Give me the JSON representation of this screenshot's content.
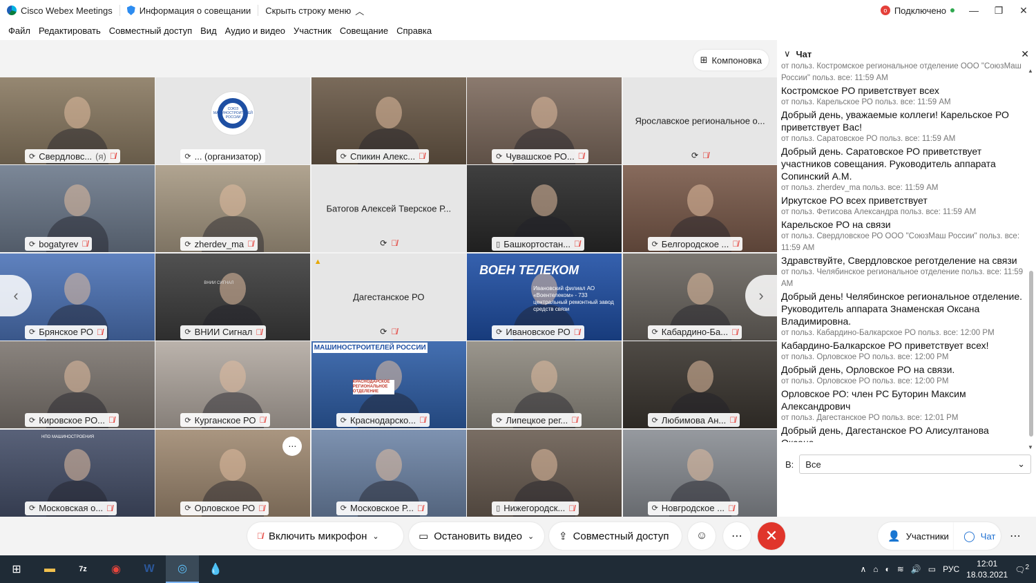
{
  "titlebar": {
    "app": "Cisco Webex Meetings",
    "meeting_info": "Информация о совещании",
    "hide_menu": "Скрыть строку меню",
    "rec_badge": "o",
    "status": "Подключено"
  },
  "menu": [
    "Файл",
    "Редактировать",
    "Совместный доступ",
    "Вид",
    "Аудио и видео",
    "Участник",
    "Совещание",
    "Справка"
  ],
  "layout_button": "Компоновка",
  "tiles": [
    {
      "name": "Свердловс...",
      "suffix": "(я)",
      "kind": "video",
      "bg": "#8a7a62"
    },
    {
      "name": "... (организатор)",
      "suffix": "",
      "kind": "logo",
      "bg": "#e6e6e6"
    },
    {
      "name": "Спикин Алекс...",
      "suffix": "",
      "kind": "video",
      "bg": "#6b5a48"
    },
    {
      "name": "Чувашское РО...",
      "suffix": "",
      "kind": "video",
      "bg": "#7e6b5e"
    },
    {
      "name": "Ярославское региональное о...",
      "suffix": "",
      "kind": "blank",
      "bg": "#e6e6e6"
    },
    {
      "name": "bogatyrev",
      "suffix": "",
      "kind": "video",
      "bg": "#6d7a8c"
    },
    {
      "name": "zherdev_ma",
      "suffix": "",
      "kind": "video",
      "bg": "#a89a84"
    },
    {
      "name": "Батогов Алексей Тверское Р...",
      "suffix": "",
      "kind": "blank",
      "bg": "#e6e6e6"
    },
    {
      "name": "Башкортостан...",
      "suffix": "",
      "kind": "video",
      "bg": "#2a2a2a"
    },
    {
      "name": "Белгородское ...",
      "suffix": "",
      "kind": "video",
      "bg": "#7a5a4a"
    },
    {
      "name": "Брянское РО",
      "suffix": "",
      "kind": "video",
      "bg": "#4d74b8"
    },
    {
      "name": "ВНИИ Сигнал",
      "suffix": "",
      "kind": "video",
      "bg": "#3d3d3d"
    },
    {
      "name": "Дагестанское РО",
      "suffix": "",
      "kind": "blank",
      "bg": "#e6e6e6"
    },
    {
      "name": "Ивановское РО",
      "suffix": "",
      "kind": "video",
      "bg": "#1f4fa5"
    },
    {
      "name": "Кабардино-Ба...",
      "suffix": "",
      "kind": "video",
      "bg": "#6b6660"
    },
    {
      "name": "Кировское РО...",
      "suffix": "",
      "kind": "video",
      "bg": "#7d7670"
    },
    {
      "name": "Курганское РО",
      "suffix": "",
      "kind": "video",
      "bg": "#b3aaa2"
    },
    {
      "name": "Краснодарско...",
      "suffix": "",
      "kind": "video",
      "bg": "#2f5fa8"
    },
    {
      "name": "Липецкое рег...",
      "suffix": "",
      "kind": "video",
      "bg": "#8f8a80"
    },
    {
      "name": "Любимова Ан...",
      "suffix": "",
      "kind": "video",
      "bg": "#3b3630"
    },
    {
      "name": "Московская о...",
      "suffix": "",
      "kind": "video",
      "bg": "#46506a"
    },
    {
      "name": "Орловское РО",
      "suffix": "",
      "kind": "video",
      "bg": "#a08a72"
    },
    {
      "name": "Московское Р...",
      "suffix": "",
      "kind": "video",
      "bg": "#6f86a8"
    },
    {
      "name": "Нижегородск...",
      "suffix": "",
      "kind": "video",
      "bg": "#6a5d52"
    },
    {
      "name": "Новгродское ...",
      "suffix": "",
      "kind": "video",
      "bg": "#8a8e94"
    }
  ],
  "tile_overlays": {
    "logo_text": "СОЮЗ МАШИНОСТРОИТЕЛЕЙ РОССИИ",
    "voentelecom": "ВОЕН ТЕЛЕКОМ",
    "voentelecom_sub": "Ивановский филиал АО «Воентелеком» - 733 центральный ремонтный завод средств связи",
    "krasnodar": "КРАСНОДАРСКОЕ РЕГИОНАЛЬНОЕ ОТДЕЛЕНИЕ",
    "krasnodar_banner": "МАШИНОСТРОИТЕЛЕЙ РОССИИ",
    "vnii": "ВНИИ СИГНАЛ",
    "npo": "НПО МАШИНОСТРОЕНИЯ"
  },
  "chat": {
    "title": "Чат",
    "messages": [
      {
        "meta": "от польз. Костромское региональное отделение ООО \"СоюзМаш России\" польз. все:    11:59 AM",
        "text": "Костромское РО приветствует всех"
      },
      {
        "meta": "от польз. Карельское РО польз. все:    11:59 AM",
        "text": "Добрый день, уважаемые коллеги! Карельское РО приветствует Вас!"
      },
      {
        "meta": "от польз. Саратовское РО польз. все:    11:59 AM",
        "text": "Добрый день. Саратовское РО приветствует участников совещания. Руководитель аппарата Сопинский А.М."
      },
      {
        "meta": "от польз. zherdev_ma польз. все:    11:59 AM",
        "text": "Иркутское РО  всех приветствует"
      },
      {
        "meta": "от польз. Фетисова Александра польз. все:    11:59 AM",
        "text": "Карельское РО на связи"
      },
      {
        "meta": "от польз. Свердловское РО ООО \"СоюзМаш России\" польз. все: 11:59 AM",
        "text": "Здравствуйте, Свердловское реготделение на связи"
      },
      {
        "meta": "от польз. Челябинское региональное отделение польз. все: 11:59 AM",
        "text": "Добрый день! Челябинское региональное отделение. Руководитель аппарата Знаменская Оксана Владимировна."
      },
      {
        "meta": "от польз. Кабардино-Балкарское РО польз. все:    12:00 PM",
        "text": "Кабардино-Балкарское РО приветствует всех!"
      },
      {
        "meta": "от польз. Орловское РО польз. все:    12:00 PM",
        "text": "Добрый день, Орловское РО на связи."
      },
      {
        "meta": "от польз. Орловское РО польз. все:    12:00 PM",
        "text": "Орловское РО: член РС Буторин Максим Александрович"
      },
      {
        "meta": "от польз. Дагестанское РО польз. все:    12:01 PM",
        "text": "Добрый день, Дагестанское РО Алисултанова Оксана"
      }
    ],
    "to_label": "В:",
    "to_value": "Все",
    "input_value": ""
  },
  "controls": {
    "mic": "Включить микрофон",
    "video": "Остановить видео",
    "share": "Совместный доступ",
    "participants": "Участники",
    "chat": "Чат"
  },
  "taskbar": {
    "lang": "РУС",
    "time": "12:01",
    "date": "18.03.2021",
    "notif_count": "2"
  }
}
